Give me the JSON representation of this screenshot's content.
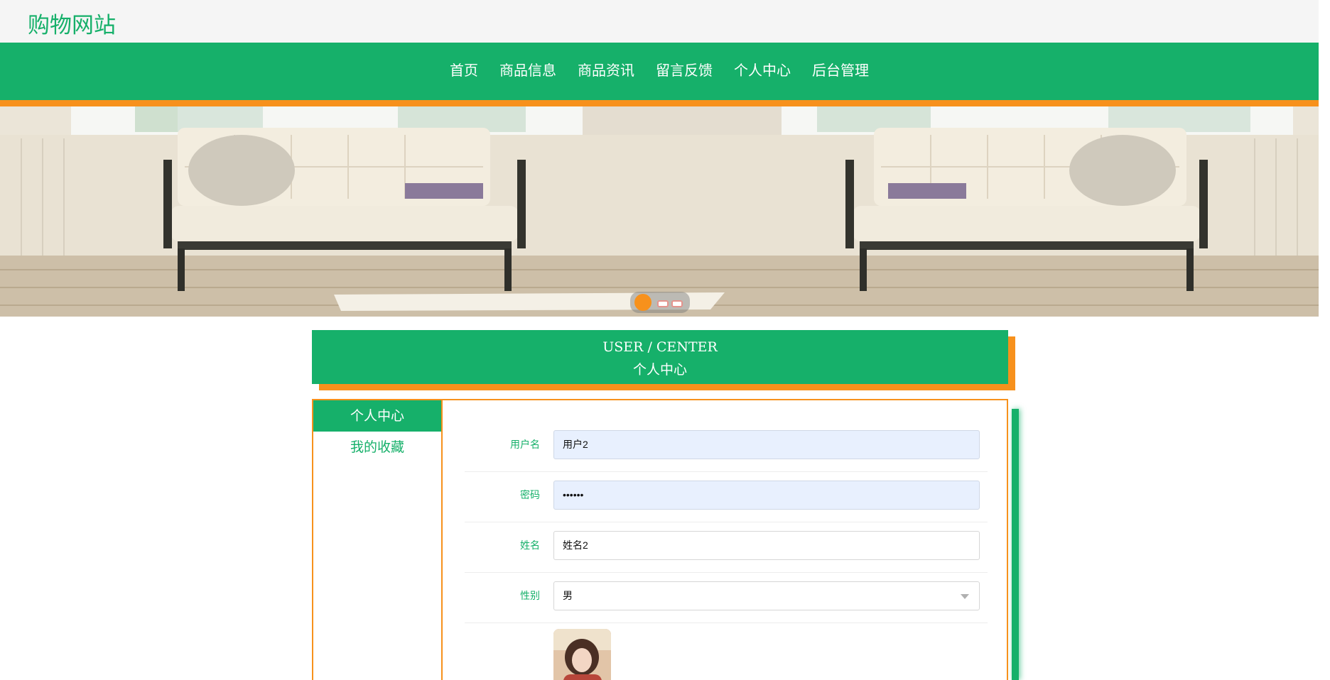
{
  "brand": {
    "title": "购物网站"
  },
  "nav": {
    "items": [
      {
        "label": "首页"
      },
      {
        "label": "商品信息"
      },
      {
        "label": "商品资讯"
      },
      {
        "label": "留言反馈"
      },
      {
        "label": "个人中心"
      },
      {
        "label": "后台管理"
      }
    ]
  },
  "carousel": {
    "slide_count": 3,
    "active_index": 0
  },
  "section": {
    "title_en": "USER / CENTER",
    "title_zh": "个人中心"
  },
  "sidebar": {
    "items": [
      {
        "label": "个人中心",
        "active": true
      },
      {
        "label": "我的收藏",
        "active": false
      }
    ]
  },
  "form": {
    "username": {
      "label": "用户名",
      "value": "用户2"
    },
    "password": {
      "label": "密码",
      "value": "••••••"
    },
    "name": {
      "label": "姓名",
      "value": "姓名2"
    },
    "gender": {
      "label": "性别",
      "value": "男"
    }
  },
  "colors": {
    "primary": "#16b06a",
    "accent": "#f7911c"
  }
}
